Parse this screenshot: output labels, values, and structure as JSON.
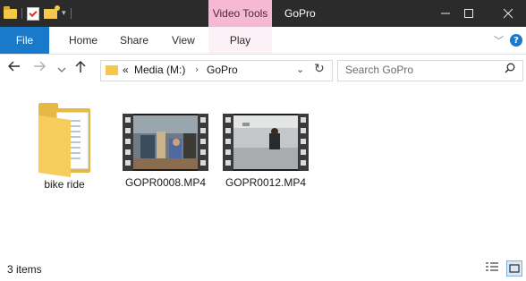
{
  "titlebar": {
    "context_tab": "Video Tools",
    "window_title": "GoPro",
    "minimize_icon": "minimize-icon",
    "maximize_icon": "maximize-icon",
    "close_icon": "close-icon"
  },
  "ribbon": {
    "tabs": [
      "File",
      "Home",
      "Share",
      "View"
    ],
    "play_tab": "Play"
  },
  "nav": {
    "overflow": "«",
    "breadcrumbs": [
      "Media (M:)",
      "GoPro"
    ],
    "search_placeholder": "Search GoPro"
  },
  "items": [
    {
      "name": "bike ride",
      "type": "folder"
    },
    {
      "name": "GOPR0008.MP4",
      "type": "video"
    },
    {
      "name": "GOPR0012.MP4",
      "type": "video"
    }
  ],
  "status": {
    "count": "3 items"
  },
  "colors": {
    "titlebar": "#2b2b2b",
    "context_tab": "#f7b8d6",
    "file_tab": "#1979ca",
    "folder": "#f6cd5c"
  }
}
